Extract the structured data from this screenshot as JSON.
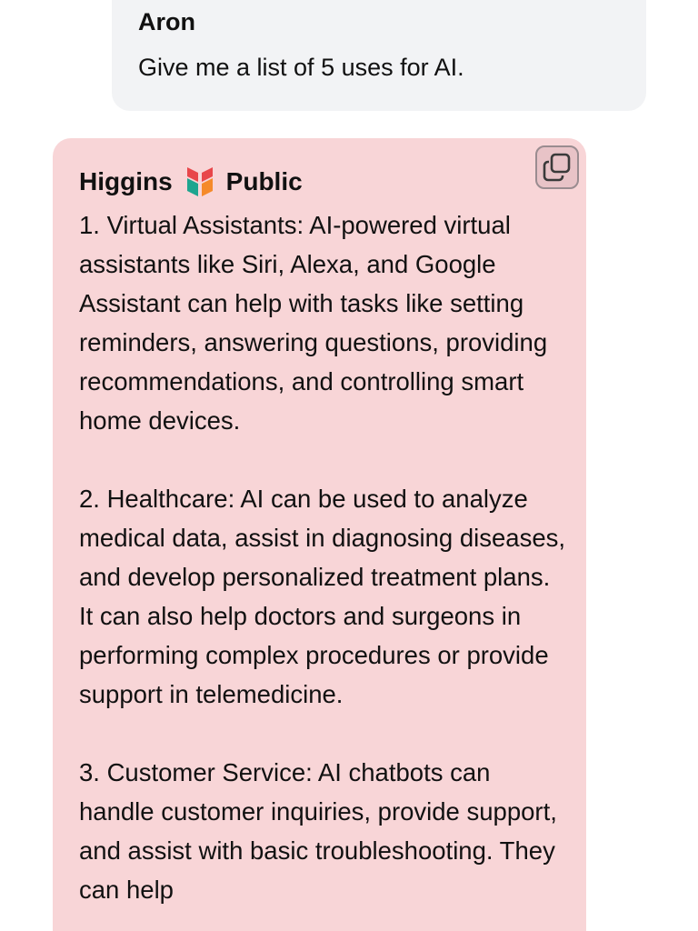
{
  "user_message": {
    "author": "Aron",
    "text": "Give me a list of 5 uses for AI."
  },
  "bot_message": {
    "author": "Higgins",
    "visibility": "Public",
    "logo_icon": "higgins-logo-icon",
    "copy_icon": "copy-icon",
    "paragraphs": [
      "1. Virtual Assistants: AI-powered virtual assistants like Siri, Alexa, and Google Assistant can help with tasks like setting reminders, answering questions, providing recommendations, and controlling smart home devices.",
      "2. Healthcare: AI can be used to analyze medical data, assist in diagnosing diseases, and develop personalized treatment plans. It can also help doctors and surgeons in performing complex procedures or provide support in telemedicine.",
      "3. Customer Service: AI chatbots can handle customer inquiries, provide support, and assist with basic troubleshooting. They can help"
    ]
  },
  "colors": {
    "user_bubble": "#f2f3f5",
    "bot_bubble": "#f8d5d7",
    "text": "#111111"
  }
}
